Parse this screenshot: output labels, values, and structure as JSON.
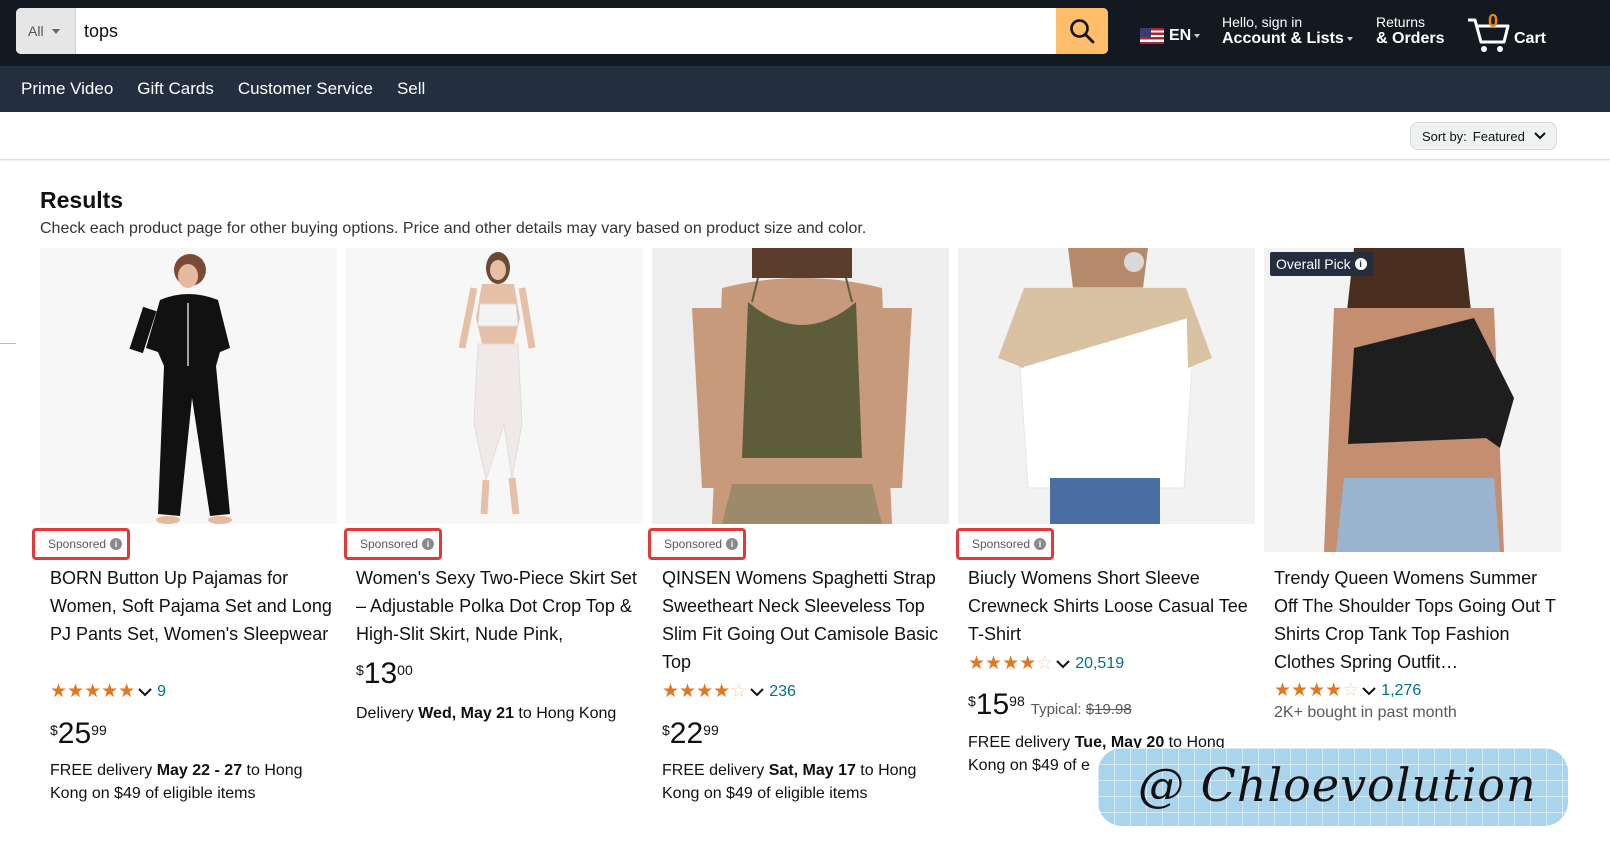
{
  "header": {
    "search": {
      "department": "All",
      "query": "tops"
    },
    "language": "EN",
    "account": {
      "greeting": "Hello, sign in",
      "label": "Account & Lists"
    },
    "returns": {
      "line1": "Returns",
      "line2": "& Orders"
    },
    "cart": {
      "count": "0",
      "label": "Cart"
    }
  },
  "nav": {
    "links": [
      "Prime Video",
      "Gift Cards",
      "Customer Service",
      "Sell"
    ]
  },
  "sort": {
    "label": "Sort by:",
    "value": "Featured"
  },
  "results": {
    "title": "Results",
    "subtitle": "Check each product page for other buying options. Price and other details may vary based on product size and color."
  },
  "products": [
    {
      "sponsored": "Sponsored",
      "title": "BORN Button Up Pajamas for Women, Soft Pajama Set and Long PJ Pants Set, Women's Sleepwear",
      "stars": "★★★★★",
      "stars_empty": "",
      "rating_count": "9",
      "price": {
        "symbol": "$",
        "whole": "25",
        "fraction": "99"
      },
      "delivery": {
        "prefix": "FREE delivery ",
        "date": "May 22 - 27",
        "suffix": " to Hong Kong on $49 of eligible items"
      }
    },
    {
      "sponsored": "Sponsored",
      "title": "Women's Sexy Two-Piece Skirt Set – Adjustable Polka Dot Crop Top & High-Slit Skirt, Nude Pink,",
      "price": {
        "symbol": "$",
        "whole": "13",
        "fraction": "00"
      },
      "delivery": {
        "prefix": "Delivery ",
        "date": "Wed, May 21",
        "suffix": " to Hong Kong"
      }
    },
    {
      "sponsored": "Sponsored",
      "title": "QINSEN Womens Spaghetti Strap Sweetheart Neck Sleeveless Top Slim Fit Going Out Camisole Basic Top",
      "stars": "★★★★",
      "stars_empty": "☆",
      "rating_count": "236",
      "price": {
        "symbol": "$",
        "whole": "22",
        "fraction": "99"
      },
      "delivery": {
        "prefix": "FREE delivery ",
        "date": "Sat, May 17",
        "suffix": " to Hong Kong on $49 of eligible items"
      }
    },
    {
      "sponsored": "Sponsored",
      "title": "Biucly Womens Short Sleeve Crewneck Shirts Loose Casual Tee T-Shirt",
      "stars": "★★★★",
      "stars_empty": "☆",
      "rating_count": "20,519",
      "price": {
        "symbol": "$",
        "whole": "15",
        "fraction": "98"
      },
      "typical": {
        "label": "Typical: ",
        "value": "$19.98"
      },
      "delivery": {
        "prefix": "FREE delivery ",
        "date": "Tue, May 20",
        "suffix": " to Hong Kong on $49 of e"
      }
    },
    {
      "badge": "Overall Pick",
      "title": "Trendy Queen Womens Summer Off The Shoulder Tops Going Out T Shirts Crop Tank Top Fashion Clothes Spring Outfit…",
      "stars": "★★★★",
      "stars_empty": "☆",
      "rating_count": "1,276",
      "bought": "2K+ bought in past month"
    }
  ],
  "watermark": "@ Chloevolution",
  "colors": {
    "header_bg": "#131921",
    "nav_bg": "#232f3e",
    "search_button": "#febd69",
    "star": "#de7921",
    "link": "#007185",
    "sponsored_highlight": "#e23a3a"
  }
}
